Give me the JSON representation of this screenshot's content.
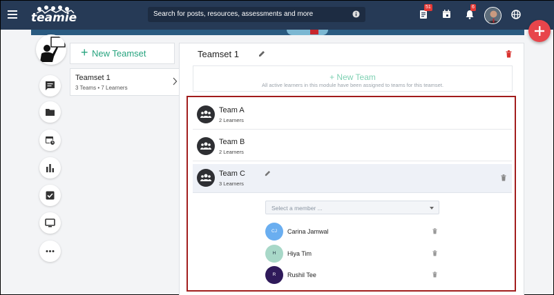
{
  "topbar": {
    "logo_text": "teamie",
    "search_placeholder": "Search for posts, resources, assessments and more",
    "notifications_badge": "51",
    "alerts_badge": "6",
    "icons": [
      "menu-icon",
      "info-icon",
      "feed-icon",
      "calendar-icon",
      "bell-icon",
      "globe-icon"
    ]
  },
  "fab": {
    "icon": "plus-icon",
    "color": "#e8454b"
  },
  "sidebar": {
    "icons": [
      "chat-icon",
      "folder-icon",
      "calendar-clock-icon",
      "bar-chart-icon",
      "checkbox-icon",
      "monitor-icon",
      "more-icon"
    ]
  },
  "teamsets": {
    "new_label": "New Teamset",
    "items": [
      {
        "title": "Teamset 1",
        "subtitle": "3 Teams • 7 Learners"
      }
    ]
  },
  "main": {
    "title": "Teamset 1",
    "new_team": {
      "label": "+ New Team",
      "note": "All active learners in this module have been assigned to teams for this teamset."
    },
    "teams": [
      {
        "name": "Team A",
        "count": "2 Learners"
      },
      {
        "name": "Team B",
        "count": "2 Learners"
      },
      {
        "name": "Team C",
        "count": "3 Learners"
      }
    ],
    "member_select_placeholder": "Select a member ...",
    "members": [
      {
        "initials": "CJ",
        "name": "Carina Jamwal",
        "color": "#6aaef0"
      },
      {
        "initials": "H",
        "name": "Hiya Tim",
        "color": "#a8d8c8"
      },
      {
        "initials": "R",
        "name": "Rushil Tee",
        "color": "#2f1a5a"
      }
    ]
  },
  "colors": {
    "topbar": "#263a56",
    "accent_green": "#26a37e",
    "highlight": "#a11b1b"
  }
}
